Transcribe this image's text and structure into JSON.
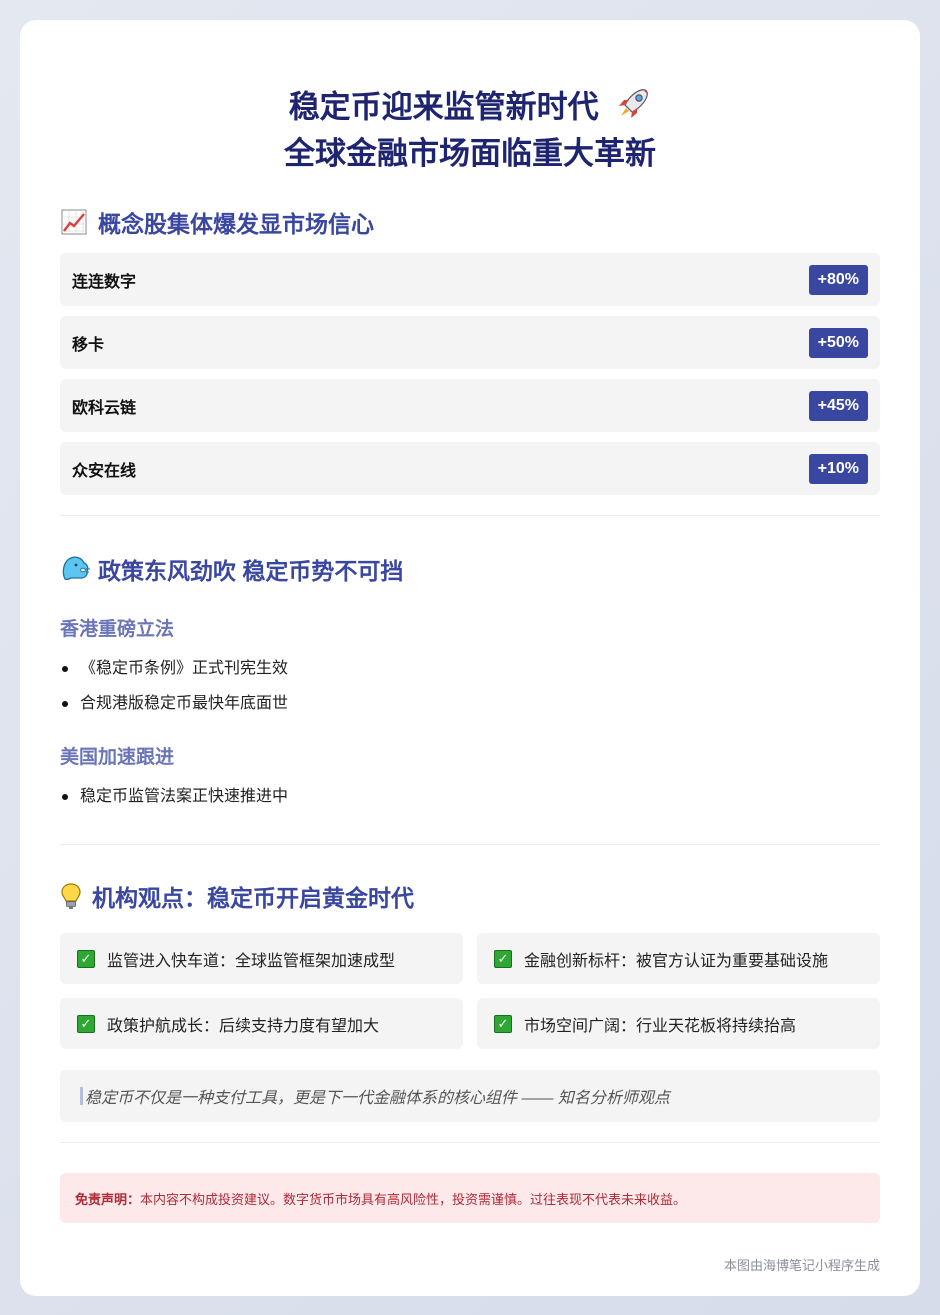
{
  "header": {
    "title_line1": "稳定币迎来监管新时代",
    "title_line2": "全球金融市场面临重大革新",
    "title_emoji": "rocket-icon"
  },
  "stocks": {
    "heading": "概念股集体爆发显市场信心",
    "heading_icon": "chart-increasing-icon",
    "items": [
      {
        "name": "连连数字",
        "change": "+80%"
      },
      {
        "name": "移卡",
        "change": "+50%"
      },
      {
        "name": "欧科云链",
        "change": "+45%"
      },
      {
        "name": "众安在线",
        "change": "+10%"
      }
    ]
  },
  "policy": {
    "heading": "政策东风劲吹 稳定币势不可挡",
    "heading_icon": "wind-face-icon",
    "hk": {
      "title": "香港重磅立法",
      "bullets": [
        "《稳定币条例》正式刊宪生效",
        "合规港版稳定币最快年底面世"
      ]
    },
    "us": {
      "title": "美国加速跟进",
      "bullets": [
        "稳定币监管法案正快速推进中"
      ]
    }
  },
  "views": {
    "heading": "机构观点：稳定币开启黄金时代",
    "heading_icon": "light-bulb-icon",
    "items": [
      "监管进入快车道：全球监管框架加速成型",
      "金融创新标杆：被官方认证为重要基础设施",
      "政策护航成长：后续支持力度有望加大",
      "市场空间广阔：行业天花板将持续抬高"
    ],
    "quote": "稳定币不仅是一种支付工具，更是下一代金融体系的核心组件 —— 知名分析师观点"
  },
  "disclaimer": {
    "label": "免责声明：",
    "text": "本内容不构成投资建议。数字货币市场具有高风险性，投资需谨慎。过往表现不代表未来收益。"
  },
  "footer": "本图由海博笔记小程序生成",
  "colors": {
    "title": "#1e2470",
    "accent": "#3a47a0",
    "subheading": "#6b76b8",
    "disclaimer_bg": "#fde8ea",
    "disclaimer_text": "#b02a37"
  }
}
